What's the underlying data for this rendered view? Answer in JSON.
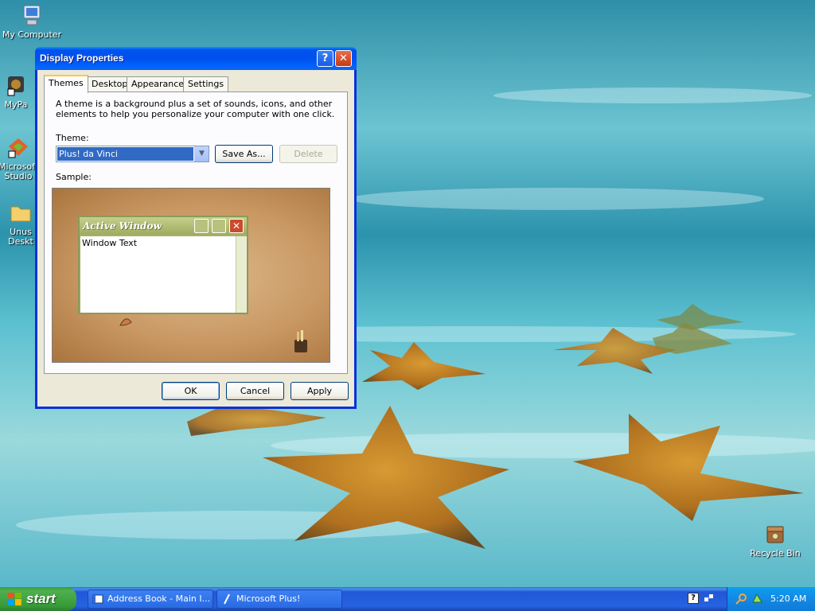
{
  "desktop": {
    "icons": [
      {
        "label": "My Computer",
        "icon": "my-computer-icon"
      },
      {
        "label": "MyPa",
        "icon": "shortcut-icon"
      },
      {
        "label": "Microsoft Studio",
        "icon": "microsoft-studio-icon"
      },
      {
        "label": "Unus Deskt",
        "icon": "folder-icon"
      },
      {
        "label": "Recycle Bin",
        "icon": "recycle-bin-icon"
      }
    ]
  },
  "dialog": {
    "title": "Display Properties",
    "help_glyph": "?",
    "close_glyph": "✕",
    "tabs": [
      "Themes",
      "Desktop",
      "Appearance",
      "Settings"
    ],
    "active_tab": "Themes",
    "description": "A theme is a background plus a set of sounds, icons, and other elements to help you personalize your computer with one click.",
    "theme_label": "Theme:",
    "theme_value": "Plus! da Vinci",
    "save_as": "Save As...",
    "delete": "Delete",
    "sample_label": "Sample:",
    "sample": {
      "window_title": "Active Window",
      "window_text": "Window Text",
      "close_glyph": "✕"
    },
    "ok": "OK",
    "cancel": "Cancel",
    "apply": "Apply"
  },
  "taskbar": {
    "start_label": "start",
    "tasks": [
      {
        "label": "Address Book - Main I...",
        "icon": "address-book-icon"
      },
      {
        "label": "Microsoft Plus!",
        "icon": "microsoft-plus-icon"
      }
    ],
    "help_glyph": "?",
    "clock": "5:20 AM"
  },
  "colors": {
    "title_blue": "#0053ee",
    "start_green": "#3c9a3c",
    "taskbar_blue": "#2663e0",
    "dialog_face": "#ece9d8"
  }
}
